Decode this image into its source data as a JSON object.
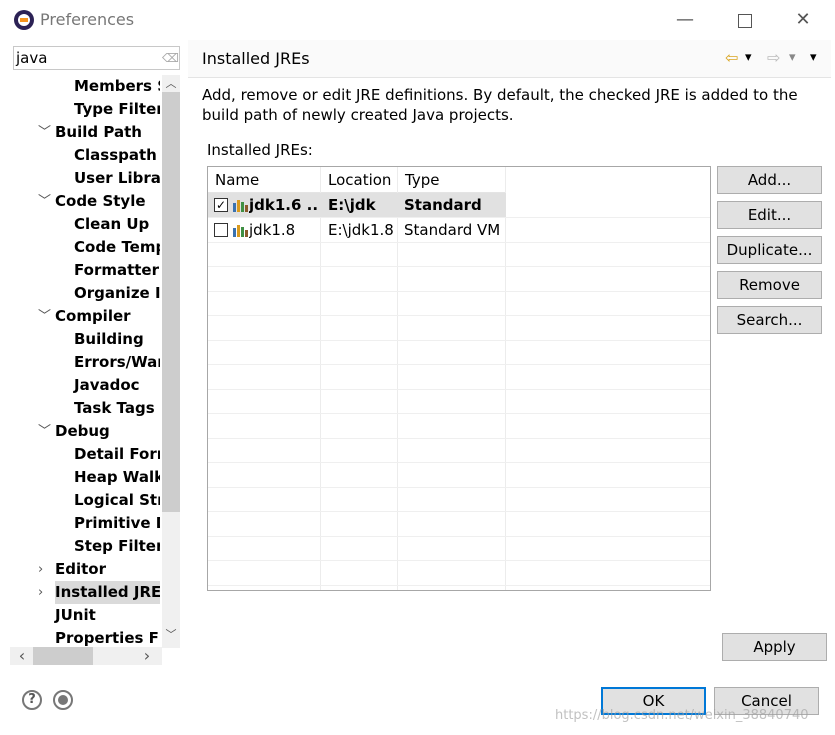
{
  "window": {
    "title": "Preferences",
    "minimize_glyph": "—",
    "close_glyph": "✕"
  },
  "sidebar": {
    "filter_value": "java",
    "filter_clear_glyph": "⌫",
    "items": [
      {
        "label": "Members S",
        "depth": 2
      },
      {
        "label": "Type Filters",
        "depth": 2
      },
      {
        "label": "Build Path",
        "depth": 1,
        "twisty": "﹀"
      },
      {
        "label": "Classpath V",
        "depth": 2
      },
      {
        "label": "User Librari",
        "depth": 2
      },
      {
        "label": "Code Style",
        "depth": 1,
        "twisty": "﹀"
      },
      {
        "label": "Clean Up",
        "depth": 2
      },
      {
        "label": "Code Temp",
        "depth": 2
      },
      {
        "label": "Formatter",
        "depth": 2
      },
      {
        "label": "Organize In",
        "depth": 2
      },
      {
        "label": "Compiler",
        "depth": 1,
        "twisty": "﹀"
      },
      {
        "label": "Building",
        "depth": 2
      },
      {
        "label": "Errors/War",
        "depth": 2
      },
      {
        "label": "Javadoc",
        "depth": 2
      },
      {
        "label": "Task Tags",
        "depth": 2
      },
      {
        "label": "Debug",
        "depth": 1,
        "twisty": "﹀"
      },
      {
        "label": "Detail Form",
        "depth": 2
      },
      {
        "label": "Heap Walk",
        "depth": 2
      },
      {
        "label": "Logical Stru",
        "depth": 2
      },
      {
        "label": "Primitive D",
        "depth": 2
      },
      {
        "label": "Step Filterin",
        "depth": 2
      },
      {
        "label": "Editor",
        "depth": 1,
        "twisty": "›"
      },
      {
        "label": "Installed JREs",
        "depth": 1,
        "twisty": "›",
        "selected": true
      },
      {
        "label": "JUnit",
        "depth": 1
      },
      {
        "label": "Properties File",
        "depth": 1
      }
    ],
    "scroll_up_glyph": "︿",
    "scroll_down_glyph": "﹀",
    "scroll_left_glyph": "‹",
    "scroll_right_glyph": "›"
  },
  "page": {
    "title": "Installed JREs",
    "nav_back_glyph": "⇦",
    "nav_forward_glyph": "⇨",
    "menu_glyph": "▾",
    "description": "Add, remove or edit JRE definitions. By default, the checked JRE is added to the build path of newly created Java projects.",
    "list_label": "Installed JREs:",
    "columns": [
      "Name",
      "Location",
      "Type"
    ],
    "jres": [
      {
        "name": "jdk1.6 ...",
        "location": "E:\\jdk",
        "type": "Standard",
        "checked": true,
        "checkmark": "✓"
      },
      {
        "name": "jdk1.8",
        "location": "E:\\jdk1.8",
        "type": "Standard VM",
        "checked": false,
        "checkmark": ""
      }
    ],
    "buttons": {
      "add": "Add...",
      "edit": "Edit...",
      "duplicate": "Duplicate...",
      "remove": "Remove",
      "search": "Search..."
    },
    "apply_label": "Apply"
  },
  "footer": {
    "help_glyph": "?",
    "ok_label": "OK",
    "cancel_label": "Cancel",
    "watermark": "https://blog.csdn.net/weixin_38840740"
  }
}
